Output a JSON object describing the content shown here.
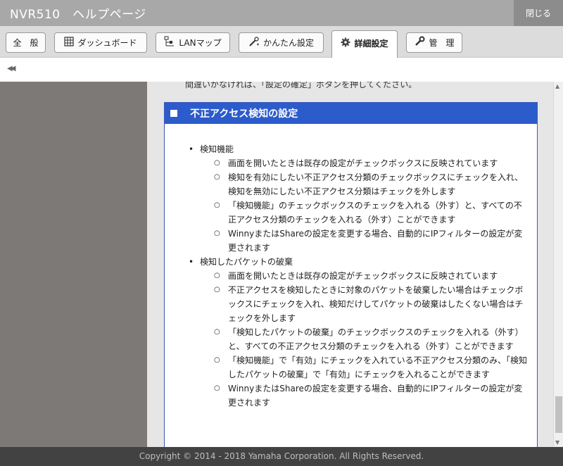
{
  "window": {
    "title": "NVR510　ヘルプページ",
    "close_label": "閉じる"
  },
  "tabs": [
    {
      "label": "全　般",
      "icon": "none",
      "active": false
    },
    {
      "label": "ダッシュボード",
      "icon": "dashboard-grid-icon",
      "active": false
    },
    {
      "label": "LANマップ",
      "icon": "lan-map-icon",
      "active": false
    },
    {
      "label": "かんたん設定",
      "icon": "wizard-icon",
      "active": false
    },
    {
      "label": "詳細設定",
      "icon": "gear-icon",
      "active": true
    },
    {
      "label": "管　理",
      "icon": "wrench-icon",
      "active": false
    }
  ],
  "content": {
    "cutoff_text": "間違いがなければ、「設定の確定」ボタンを押してください。",
    "section_title": "不正アクセス検知の設定",
    "sections": [
      {
        "heading": "検知機能",
        "items": [
          "画面を開いたときは既存の設定がチェックボックスに反映されています",
          "検知を有効にしたい不正アクセス分類のチェックボックスにチェックを入れ、検知を無効にしたい不正アクセス分類はチェックを外します",
          "「検知機能」のチェックボックスのチェックを入れる（外す）と、すべての不正アクセス分類のチェックを入れる（外す）ことができます",
          "WinnyまたはShareの設定を変更する場合、自動的にIPフィルターの設定が変更されます"
        ]
      },
      {
        "heading": "検知したパケットの破棄",
        "items": [
          "画面を開いたときは既存の設定がチェックボックスに反映されています",
          "不正アクセスを検知したときに対象のパケットを破棄したい場合はチェックボックスにチェックを入れ、検知だけしてパケットの破棄はしたくない場合はチェックを外します",
          "「検知したパケットの破棄」のチェックボックスのチェックを入れる（外す）と、すべての不正アクセス分類のチェックを入れる（外す）ことができます",
          "「検知機能」で「有効」にチェックを入れている不正アクセス分類のみ、「検知したパケットの破棄」で「有効」にチェックを入れることができます",
          "WinnyまたはShareの設定を変更する場合、自動的にIPフィルターの設定が変更されます"
        ]
      }
    ]
  },
  "footer": {
    "copyright": "Copyright © 2014 - 2018 Yamaha Corporation. All Rights Reserved."
  },
  "colors": {
    "titlebar": "#a8a8a8",
    "close_button": "#8c8c8c",
    "section_header": "#2c5bcb",
    "sidebar": "#7d7977",
    "footer": "#424242"
  }
}
